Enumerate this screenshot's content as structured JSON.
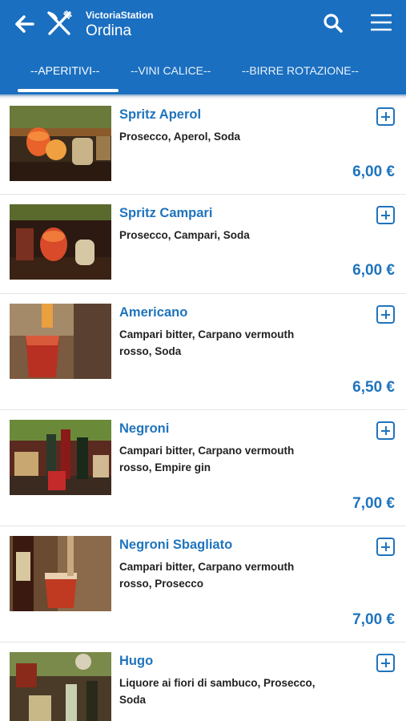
{
  "app": {
    "name": "VictoriaStation",
    "title": "Ordina"
  },
  "tabs": [
    {
      "label": "--APERITIVI--",
      "active": true
    },
    {
      "label": "--VINI CALICE--",
      "active": false
    },
    {
      "label": "--BIRRE ROTAZIONE--",
      "active": false
    }
  ],
  "colors": {
    "primary": "#1a6fc0",
    "accent_text": "#1f74bd"
  },
  "icons": {
    "back": "arrow-left-icon",
    "logo": "fork-knife-icon",
    "search": "search-icon",
    "menu": "hamburger-menu-icon",
    "add": "plus-square-icon"
  },
  "items": [
    {
      "name": "Spritz Aperol",
      "desc": "Prosecco, Aperol, Soda",
      "price": "6,00 €"
    },
    {
      "name": "Spritz Campari",
      "desc": "Prosecco, Campari, Soda",
      "price": "6,00 €"
    },
    {
      "name": "Americano",
      "desc": "Campari bitter, Carpano vermouth rosso, Soda",
      "price": "6,50 €"
    },
    {
      "name": "Negroni",
      "desc": "Campari bitter, Carpano vermouth rosso, Empire gin",
      "price": "7,00 €"
    },
    {
      "name": "Negroni Sbagliato",
      "desc": "Campari bitter, Carpano vermouth rosso, Prosecco",
      "price": "7,00 €"
    },
    {
      "name": "Hugo",
      "desc": "Liquore ai fiori di sambuco, Prosecco, Soda",
      "price": ""
    }
  ]
}
